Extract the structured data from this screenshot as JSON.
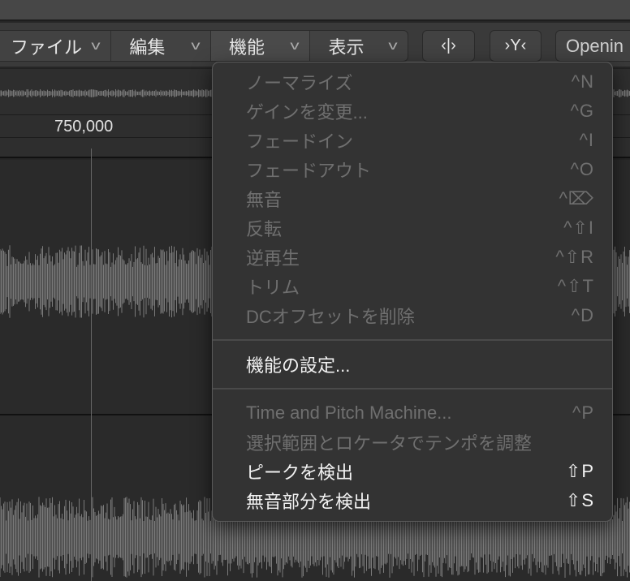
{
  "toolbar": {
    "menus": [
      {
        "label": "ファイル"
      },
      {
        "label": "編集"
      },
      {
        "label": "機能"
      },
      {
        "label": "表示"
      }
    ],
    "button_split": "‹|›",
    "button_catch": "›Y‹",
    "button_text": "Openin"
  },
  "ruler": {
    "label": "750,000"
  },
  "menu": {
    "group1": [
      {
        "label": "ノーマライズ",
        "shortcut": "^N",
        "enabled": false
      },
      {
        "label": "ゲインを変更...",
        "shortcut": "^G",
        "enabled": false
      },
      {
        "label": "フェードイン",
        "shortcut": "^I",
        "enabled": false
      },
      {
        "label": "フェードアウト",
        "shortcut": "^O",
        "enabled": false
      },
      {
        "label": "無音",
        "shortcut": "^⌦",
        "enabled": false
      },
      {
        "label": "反転",
        "shortcut": "^⇧I",
        "enabled": false
      },
      {
        "label": "逆再生",
        "shortcut": "^⇧R",
        "enabled": false
      },
      {
        "label": "トリム",
        "shortcut": "^⇧T",
        "enabled": false
      },
      {
        "label": "DCオフセットを削除",
        "shortcut": "^D",
        "enabled": false
      }
    ],
    "settings": {
      "label": "機能の設定...",
      "enabled": true
    },
    "group3": [
      {
        "label": "Time and Pitch Machine...",
        "shortcut": "^P",
        "enabled": false
      },
      {
        "label": "選択範囲とロケータでテンポを調整",
        "shortcut": "",
        "enabled": false
      },
      {
        "label": "ピークを検出",
        "shortcut": "⇧P",
        "enabled": true
      },
      {
        "label": "無音部分を検出",
        "shortcut": "⇧S",
        "enabled": true
      }
    ]
  }
}
